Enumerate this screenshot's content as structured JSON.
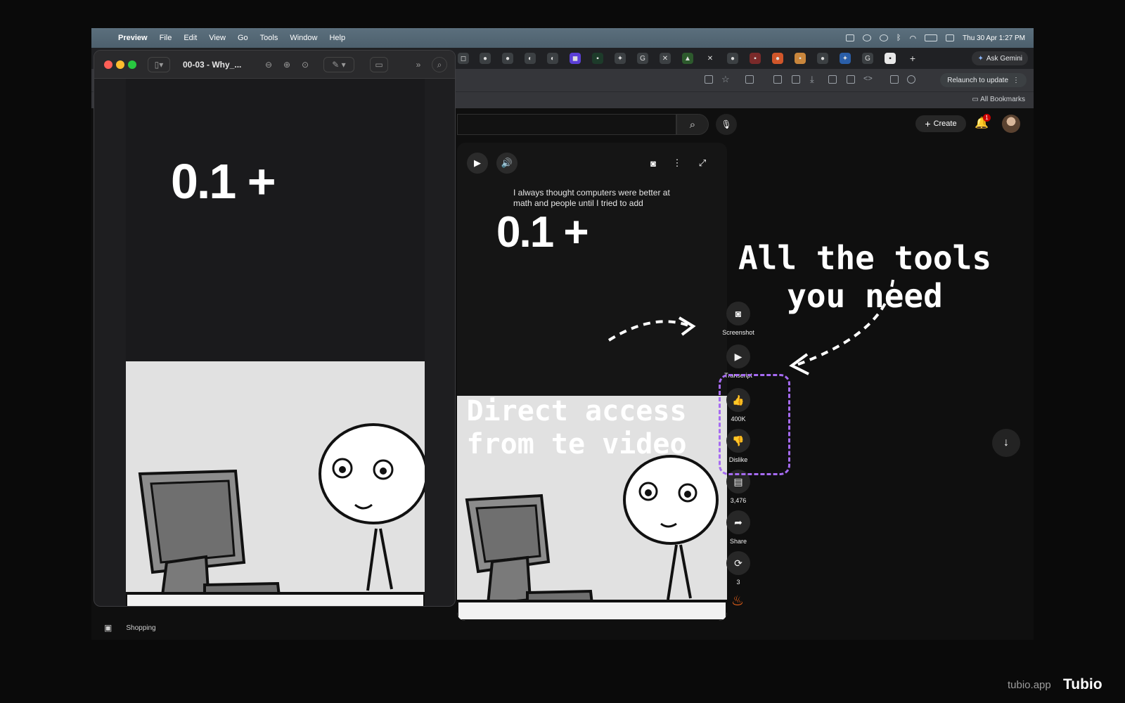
{
  "menubar": {
    "items": [
      "Preview",
      "File",
      "Edit",
      "View",
      "Go",
      "Tools",
      "Window",
      "Help"
    ],
    "clock": "Thu 30 Apr  1:27 PM"
  },
  "chrome": {
    "ask_gemini": "Ask Gemini",
    "relaunch": "Relaunch to update",
    "all_bookmarks": "All Bookmarks"
  },
  "youtube": {
    "create_label": "Create",
    "notification_count": "1",
    "caption": "I always thought computers were better at math and people until I tried to add",
    "formula": "0.1 +",
    "rail": {
      "screenshot": "Screenshot",
      "transcript": "Transcript",
      "likes": "400K",
      "dislike": "Dislike",
      "comments": "3,476",
      "share": "Share",
      "remix": "3"
    }
  },
  "annotations": {
    "tools_line1": "All the tools",
    "tools_line2": "you need",
    "access_line1": "Direct access",
    "access_line2": "from te video"
  },
  "preview": {
    "title": "00-03 - Why_...",
    "formula": "0.1 +"
  },
  "bottom": {
    "shopping": "Shopping"
  },
  "branding": {
    "domain": "tubio.app",
    "name": "Tubio"
  },
  "colors": {
    "highlight": "#a66bf2",
    "notification": "#cc0000"
  }
}
